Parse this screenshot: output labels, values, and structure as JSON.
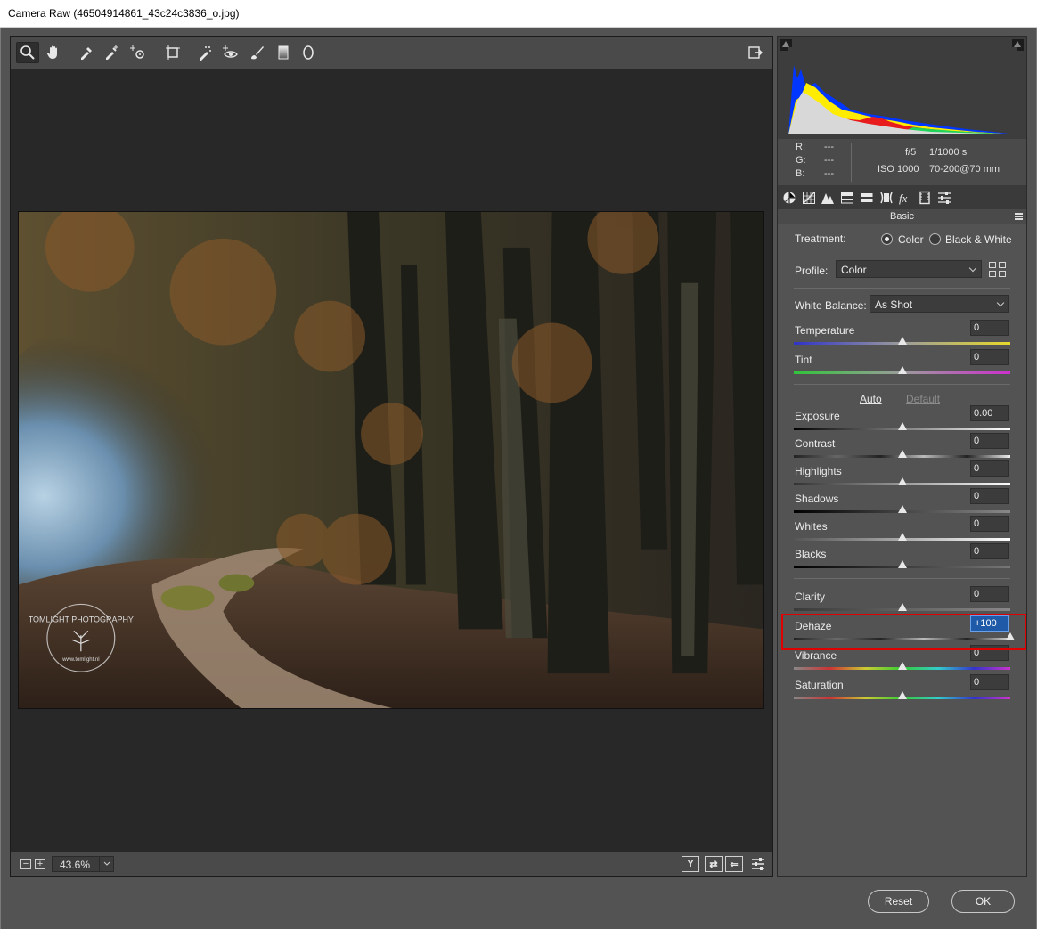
{
  "window": {
    "title": "Camera Raw (46504914861_43c24c3836_o.jpg)"
  },
  "toolbar": {
    "tools": [
      "zoom-icon",
      "hand-icon",
      "white-balance-icon",
      "color-sampler-icon",
      "targeted-adjustment-icon",
      "transform-icon",
      "spot-removal-icon",
      "red-eye-icon",
      "adjustment-brush-icon",
      "graduated-filter-icon",
      "radial-filter-icon"
    ],
    "preferences_icon": "open-preferences-icon"
  },
  "photo": {
    "watermark": "TOMLIGHT PHOTOGRAPHY",
    "watermark_url": "www.tomlight.nl"
  },
  "statusbar": {
    "zoom_value": "43.6%",
    "view_buttons": [
      "Y",
      "⇄",
      "⇐"
    ]
  },
  "info": {
    "r_label": "R:",
    "r_value": "---",
    "g_label": "G:",
    "g_value": "---",
    "b_label": "B:",
    "b_value": "---",
    "aperture": "f/5",
    "shutter": "1/1000 s",
    "iso": "ISO 1000",
    "lens": "70-200@70 mm"
  },
  "panel": {
    "section_title": "Basic",
    "treatment_label": "Treatment:",
    "treatment_color": "Color",
    "treatment_bw": "Black & White",
    "profile_label": "Profile:",
    "profile_value": "Color",
    "wb_label": "White Balance:",
    "wb_value": "As Shot",
    "auto_label": "Auto",
    "default_label": "Default"
  },
  "sliders": {
    "temperature": {
      "label": "Temperature",
      "value": "0"
    },
    "tint": {
      "label": "Tint",
      "value": "0"
    },
    "exposure": {
      "label": "Exposure",
      "value": "0.00"
    },
    "contrast": {
      "label": "Contrast",
      "value": "0"
    },
    "highlights": {
      "label": "Highlights",
      "value": "0"
    },
    "shadows": {
      "label": "Shadows",
      "value": "0"
    },
    "whites": {
      "label": "Whites",
      "value": "0"
    },
    "blacks": {
      "label": "Blacks",
      "value": "0"
    },
    "clarity": {
      "label": "Clarity",
      "value": "0"
    },
    "dehaze": {
      "label": "Dehaze",
      "value": "+100"
    },
    "vibrance": {
      "label": "Vibrance",
      "value": "0"
    },
    "saturation": {
      "label": "Saturation",
      "value": "0"
    }
  },
  "slider_positions": {
    "temperature": 0.5,
    "tint": 0.5,
    "exposure": 0.5,
    "contrast": 0.5,
    "highlights": 0.5,
    "shadows": 0.5,
    "whites": 0.5,
    "blacks": 0.5,
    "clarity": 0.5,
    "dehaze": 1.0,
    "vibrance": 0.5,
    "saturation": 0.5
  },
  "buttons": {
    "reset": "Reset",
    "ok": "OK"
  },
  "colors": {
    "highlight": "#e00000",
    "active_field": "#1f5aa8"
  }
}
